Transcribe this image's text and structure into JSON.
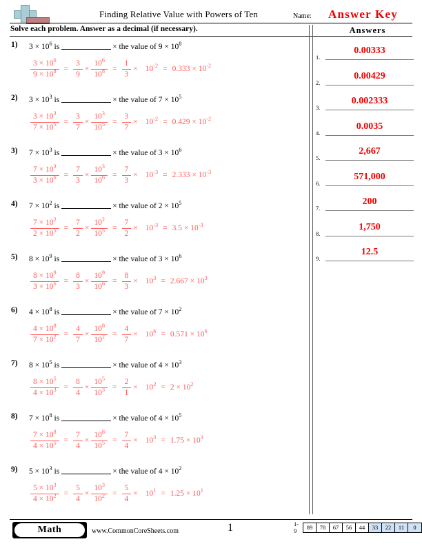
{
  "header": {
    "logo_icon": "plus-logo-icon",
    "title": "Finding Relative Value with Powers of Ten",
    "name_label": "Name:",
    "answer_key_text": "Answer Key",
    "answer_key_color": "#ee0000"
  },
  "instructions": "Solve each problem. Answer as a decimal (if necessary).",
  "answers_heading": "Answers",
  "problems": [
    {
      "number": "1)",
      "stmt_lead": "3 × 10",
      "stmt_lead_exp": "6",
      "stmt_is": "is",
      "stmt_mid": "× the value of 9 × 10",
      "stmt_mid_exp": "8",
      "f1_num": "3 × 10",
      "f1_num_exp": "6",
      "f1_den": "9 × 10",
      "f1_den_exp": "8",
      "f2_num": "3",
      "f2_den": "9",
      "f3_num": "10",
      "f3_num_exp": "6",
      "f3_den": "10",
      "f3_den_exp": "8",
      "f4_num": "1",
      "f4_den": "3",
      "pow_base": "10",
      "pow_exp": "-2",
      "result": "0.333 × 10",
      "result_exp": "-2"
    },
    {
      "number": "2)",
      "stmt_lead": "3 × 10",
      "stmt_lead_exp": "3",
      "stmt_is": "is",
      "stmt_mid": "× the value of 7 × 10",
      "stmt_mid_exp": "5",
      "f1_num": "3 × 10",
      "f1_num_exp": "3",
      "f1_den": "7 × 10",
      "f1_den_exp": "5",
      "f2_num": "3",
      "f2_den": "7",
      "f3_num": "10",
      "f3_num_exp": "3",
      "f3_den": "10",
      "f3_den_exp": "5",
      "f4_num": "3",
      "f4_den": "7",
      "pow_base": "10",
      "pow_exp": "-2",
      "result": "0.429 × 10",
      "result_exp": "-2"
    },
    {
      "number": "3)",
      "stmt_lead": "7 × 10",
      "stmt_lead_exp": "3",
      "stmt_is": "is",
      "stmt_mid": "× the value of 3 × 10",
      "stmt_mid_exp": "6",
      "f1_num": "7 × 10",
      "f1_num_exp": "3",
      "f1_den": "3 × 10",
      "f1_den_exp": "6",
      "f2_num": "7",
      "f2_den": "3",
      "f3_num": "10",
      "f3_num_exp": "3",
      "f3_den": "10",
      "f3_den_exp": "6",
      "f4_num": "7",
      "f4_den": "3",
      "pow_base": "10",
      "pow_exp": "-3",
      "result": "2.333 × 10",
      "result_exp": "-3"
    },
    {
      "number": "4)",
      "stmt_lead": "7 × 10",
      "stmt_lead_exp": "2",
      "stmt_is": "is",
      "stmt_mid": "× the value of 2 × 10",
      "stmt_mid_exp": "5",
      "f1_num": "7 × 10",
      "f1_num_exp": "2",
      "f1_den": "2 × 10",
      "f1_den_exp": "5",
      "f2_num": "7",
      "f2_den": "2",
      "f3_num": "10",
      "f3_num_exp": "2",
      "f3_den": "10",
      "f3_den_exp": "5",
      "f4_num": "7",
      "f4_den": "2",
      "pow_base": "10",
      "pow_exp": "-3",
      "result": "3.5 × 10",
      "result_exp": "-3"
    },
    {
      "number": "5)",
      "stmt_lead": "8 × 10",
      "stmt_lead_exp": "9",
      "stmt_is": "is",
      "stmt_mid": "× the value of 3 × 10",
      "stmt_mid_exp": "6",
      "f1_num": "8 × 10",
      "f1_num_exp": "9",
      "f1_den": "3 × 10",
      "f1_den_exp": "6",
      "f2_num": "8",
      "f2_den": "3",
      "f3_num": "10",
      "f3_num_exp": "9",
      "f3_den": "10",
      "f3_den_exp": "6",
      "f4_num": "8",
      "f4_den": "3",
      "pow_base": "10",
      "pow_exp": "3",
      "result": "2.667 × 10",
      "result_exp": "3"
    },
    {
      "number": "6)",
      "stmt_lead": "4 × 10",
      "stmt_lead_exp": "8",
      "stmt_is": "is",
      "stmt_mid": "× the value of 7 × 10",
      "stmt_mid_exp": "2",
      "f1_num": "4 × 10",
      "f1_num_exp": "8",
      "f1_den": "7 × 10",
      "f1_den_exp": "2",
      "f2_num": "4",
      "f2_den": "7",
      "f3_num": "10",
      "f3_num_exp": "8",
      "f3_den": "10",
      "f3_den_exp": "2",
      "f4_num": "4",
      "f4_den": "7",
      "pow_base": "10",
      "pow_exp": "6",
      "result": "0.571 × 10",
      "result_exp": "6"
    },
    {
      "number": "7)",
      "stmt_lead": "8 × 10",
      "stmt_lead_exp": "5",
      "stmt_is": "is",
      "stmt_mid": "× the value of 4 × 10",
      "stmt_mid_exp": "3",
      "f1_num": "8 × 10",
      "f1_num_exp": "5",
      "f1_den": "4 × 10",
      "f1_den_exp": "3",
      "f2_num": "8",
      "f2_den": "4",
      "f3_num": "10",
      "f3_num_exp": "5",
      "f3_den": "10",
      "f3_den_exp": "3",
      "f4_num": "2",
      "f4_den": "1",
      "pow_base": "10",
      "pow_exp": "2",
      "result": "2 × 10",
      "result_exp": "2"
    },
    {
      "number": "8)",
      "stmt_lead": "7 × 10",
      "stmt_lead_exp": "8",
      "stmt_is": "is",
      "stmt_mid": "× the value of 4 × 10",
      "stmt_mid_exp": "5",
      "f1_num": "7 × 10",
      "f1_num_exp": "8",
      "f1_den": "4 × 10",
      "f1_den_exp": "5",
      "f2_num": "7",
      "f2_den": "4",
      "f3_num": "10",
      "f3_num_exp": "8",
      "f3_den": "10",
      "f3_den_exp": "5",
      "f4_num": "7",
      "f4_den": "4",
      "pow_base": "10",
      "pow_exp": "3",
      "result": "1.75 × 10",
      "result_exp": "3"
    },
    {
      "number": "9)",
      "stmt_lead": "5 × 10",
      "stmt_lead_exp": "3",
      "stmt_is": "is",
      "stmt_mid": "× the value of 4 × 10",
      "stmt_mid_exp": "2",
      "f1_num": "5 × 10",
      "f1_num_exp": "3",
      "f1_den": "4 × 10",
      "f1_den_exp": "2",
      "f2_num": "5",
      "f2_den": "4",
      "f3_num": "10",
      "f3_num_exp": "3",
      "f3_den": "10",
      "f3_den_exp": "2",
      "f4_num": "5",
      "f4_den": "4",
      "pow_base": "10",
      "pow_exp": "1",
      "result": "1.25 × 10",
      "result_exp": "1"
    }
  ],
  "equals_sign": "=",
  "times_sign": "×",
  "answers": [
    {
      "num": "1.",
      "value": "0.00333"
    },
    {
      "num": "2.",
      "value": "0.00429"
    },
    {
      "num": "3.",
      "value": "0.002333"
    },
    {
      "num": "4.",
      "value": "0.0035"
    },
    {
      "num": "5.",
      "value": "2,667"
    },
    {
      "num": "6.",
      "value": "571,000"
    },
    {
      "num": "7.",
      "value": "200"
    },
    {
      "num": "8.",
      "value": "1,750"
    },
    {
      "num": "9.",
      "value": "12.5"
    }
  ],
  "footer": {
    "subject_badge": "Math",
    "website": "www.CommonCoreSheets.com",
    "page_number": "1",
    "score_label": "1-9",
    "score_cells": [
      {
        "value": "89",
        "highlighted": false
      },
      {
        "value": "78",
        "highlighted": false
      },
      {
        "value": "67",
        "highlighted": false
      },
      {
        "value": "56",
        "highlighted": false
      },
      {
        "value": "44",
        "highlighted": false
      },
      {
        "value": "33",
        "highlighted": true
      },
      {
        "value": "22",
        "highlighted": true
      },
      {
        "value": "11",
        "highlighted": true
      },
      {
        "value": "0",
        "highlighted": true
      }
    ],
    "highlight_color": "#cfe2f7"
  }
}
